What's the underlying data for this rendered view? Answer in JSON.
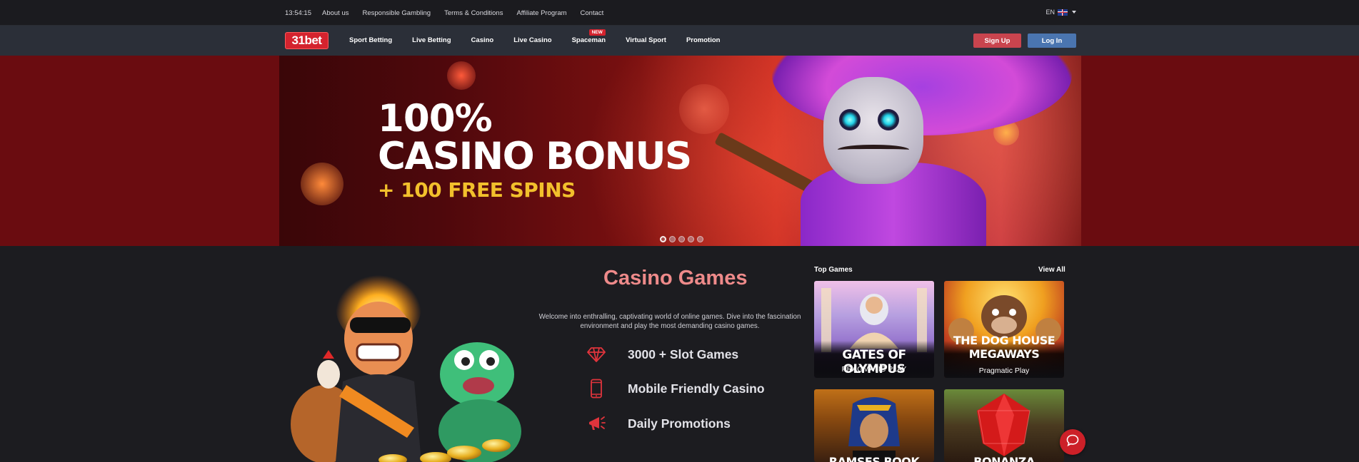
{
  "topbar": {
    "clock": "13:54:15",
    "links": [
      "About us",
      "Responsible Gambling",
      "Terms & Conditions",
      "Affiliate Program",
      "Contact"
    ],
    "language": "EN"
  },
  "navbar": {
    "logo": "31bet",
    "links": [
      "Sport Betting",
      "Live Betting",
      "Casino",
      "Live Casino",
      "Spaceman",
      "Virtual Sport",
      "Promotion"
    ],
    "new_badge": "NEW",
    "signup_label": "Sign Up",
    "login_label": "Log In"
  },
  "hero": {
    "line1": "100%",
    "line2": "CASINO BONUS",
    "line3": "+ 100 FREE SPINS",
    "slide_count": 5,
    "active_slide": 1
  },
  "casino": {
    "title": "Casino Games",
    "description": "Welcome into enthralling, captivating world of online games. Dive into the fascination environment and play the most demanding casino games.",
    "features": [
      {
        "icon": "diamond-icon",
        "text": "3000 + Slot Games"
      },
      {
        "icon": "mobile-phone-icon",
        "text": "Mobile Friendly Casino"
      },
      {
        "icon": "megaphone-icon",
        "text": "Daily Promotions"
      }
    ]
  },
  "top_games": {
    "title": "Top Games",
    "view_all": "View All",
    "games": [
      {
        "name": "GATES OF OLYMPUS",
        "provider": "PRAGMATIC PLAY"
      },
      {
        "name": "THE DOG HOUSE MEGAWAYS",
        "name_line1": "THE DOG HOUSE",
        "name_line2": "MEGAWAYS",
        "provider": "Pragmatic Play"
      },
      {
        "name": "RAMSES BOOK"
      },
      {
        "name": "BONANZA"
      }
    ]
  },
  "colors": {
    "accent_red": "#d4232e",
    "title_pink": "#ee8a8a",
    "signup": "#c9444e",
    "login": "#4a75b0",
    "bonus_yellow": "#f2c02c"
  }
}
